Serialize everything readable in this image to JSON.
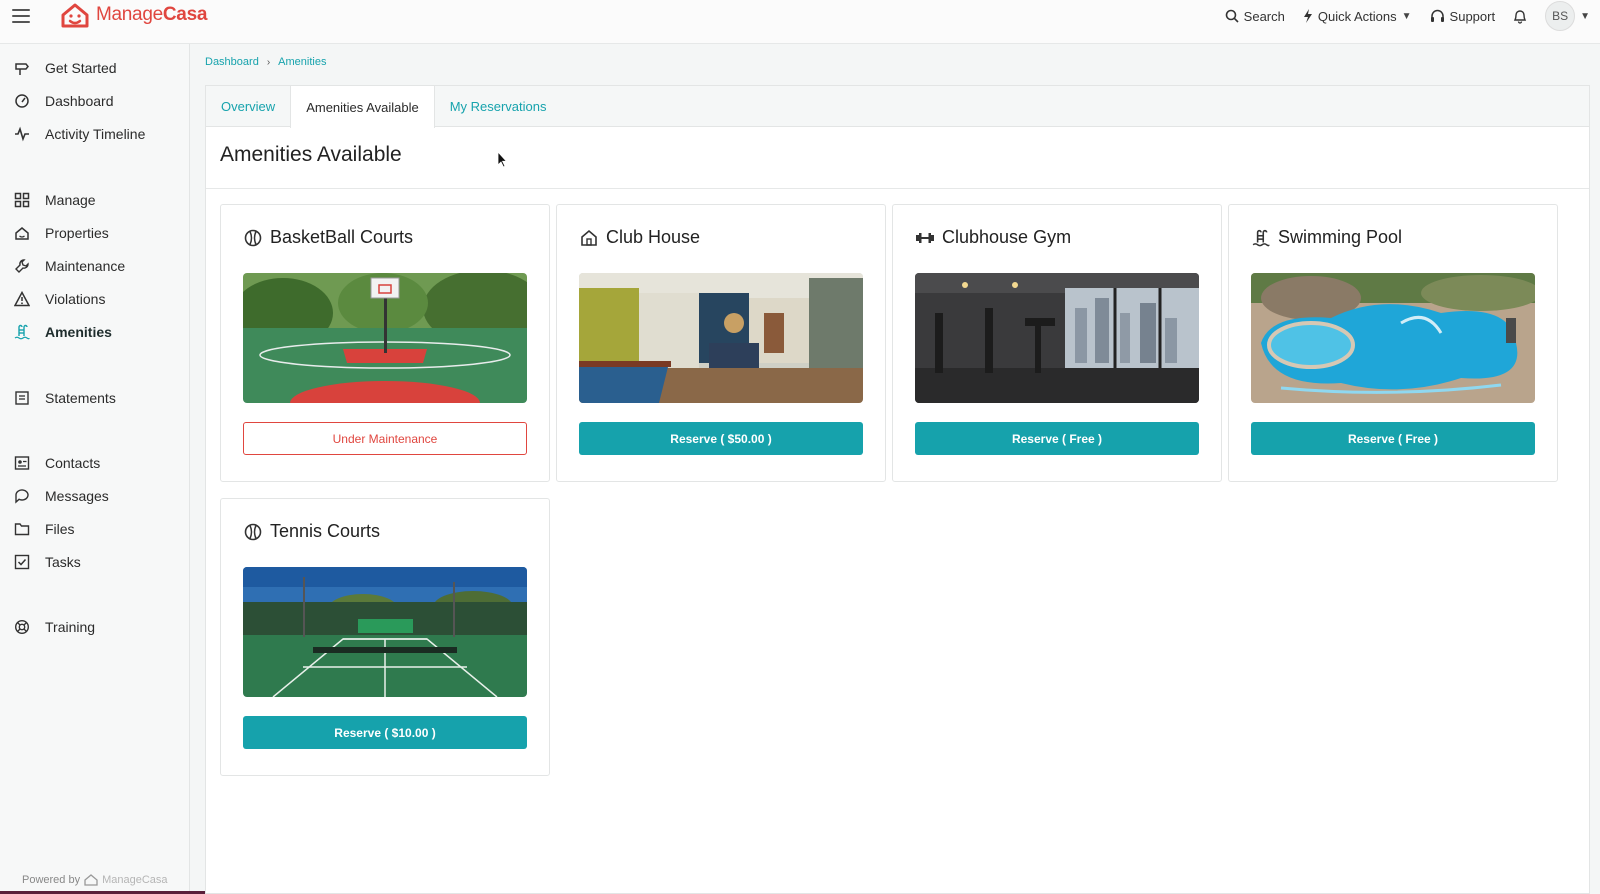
{
  "app": {
    "logo_text_light": "Manage",
    "logo_text_bold": "Casa",
    "brand_color": "#e0463f",
    "accent_color": "#16a2ac"
  },
  "topbar": {
    "search_label": "Search",
    "quick_actions_label": "Quick Actions",
    "support_label": "Support",
    "avatar_initials": "BS"
  },
  "sidebar": {
    "items": [
      {
        "label": "Get Started",
        "icon": "signpost-icon"
      },
      {
        "label": "Dashboard",
        "icon": "gauge-icon"
      },
      {
        "label": "Activity Timeline",
        "icon": "pulse-icon"
      },
      {
        "label": "Manage",
        "icon": "grid-icon"
      },
      {
        "label": "Properties",
        "icon": "building-icon"
      },
      {
        "label": "Maintenance",
        "icon": "wrench-icon"
      },
      {
        "label": "Violations",
        "icon": "warning-icon"
      },
      {
        "label": "Amenities",
        "icon": "pool-ladder-icon",
        "active": true
      },
      {
        "label": "Statements",
        "icon": "statement-icon"
      },
      {
        "label": "Contacts",
        "icon": "contact-card-icon"
      },
      {
        "label": "Messages",
        "icon": "chat-icon"
      },
      {
        "label": "Files",
        "icon": "folder-icon"
      },
      {
        "label": "Tasks",
        "icon": "checkbox-icon"
      },
      {
        "label": "Training",
        "icon": "lifebuoy-icon"
      }
    ],
    "powered_by": "Powered by",
    "powered_brand": "ManageCasa"
  },
  "breadcrumb": {
    "home": "Dashboard",
    "current": "Amenities"
  },
  "tabs": [
    {
      "label": "Overview"
    },
    {
      "label": "Amenities Available",
      "active": true
    },
    {
      "label": "My Reservations"
    }
  ],
  "page_title": "Amenities Available",
  "amenities": [
    {
      "title": "BasketBall Courts",
      "icon": "ball-icon",
      "button": "Under Maintenance",
      "status": "maintenance"
    },
    {
      "title": "Club House",
      "icon": "house-icon",
      "button": "Reserve ( $50.00 )",
      "status": "reservable"
    },
    {
      "title": "Clubhouse Gym",
      "icon": "dumbbell-icon",
      "button": "Reserve ( Free )",
      "status": "reservable"
    },
    {
      "title": "Swimming Pool",
      "icon": "pool-ladder-icon",
      "button": "Reserve ( Free )",
      "status": "reservable"
    },
    {
      "title": "Tennis Courts",
      "icon": "ball-icon",
      "button": "Reserve ( $10.00 )",
      "status": "reservable"
    }
  ]
}
